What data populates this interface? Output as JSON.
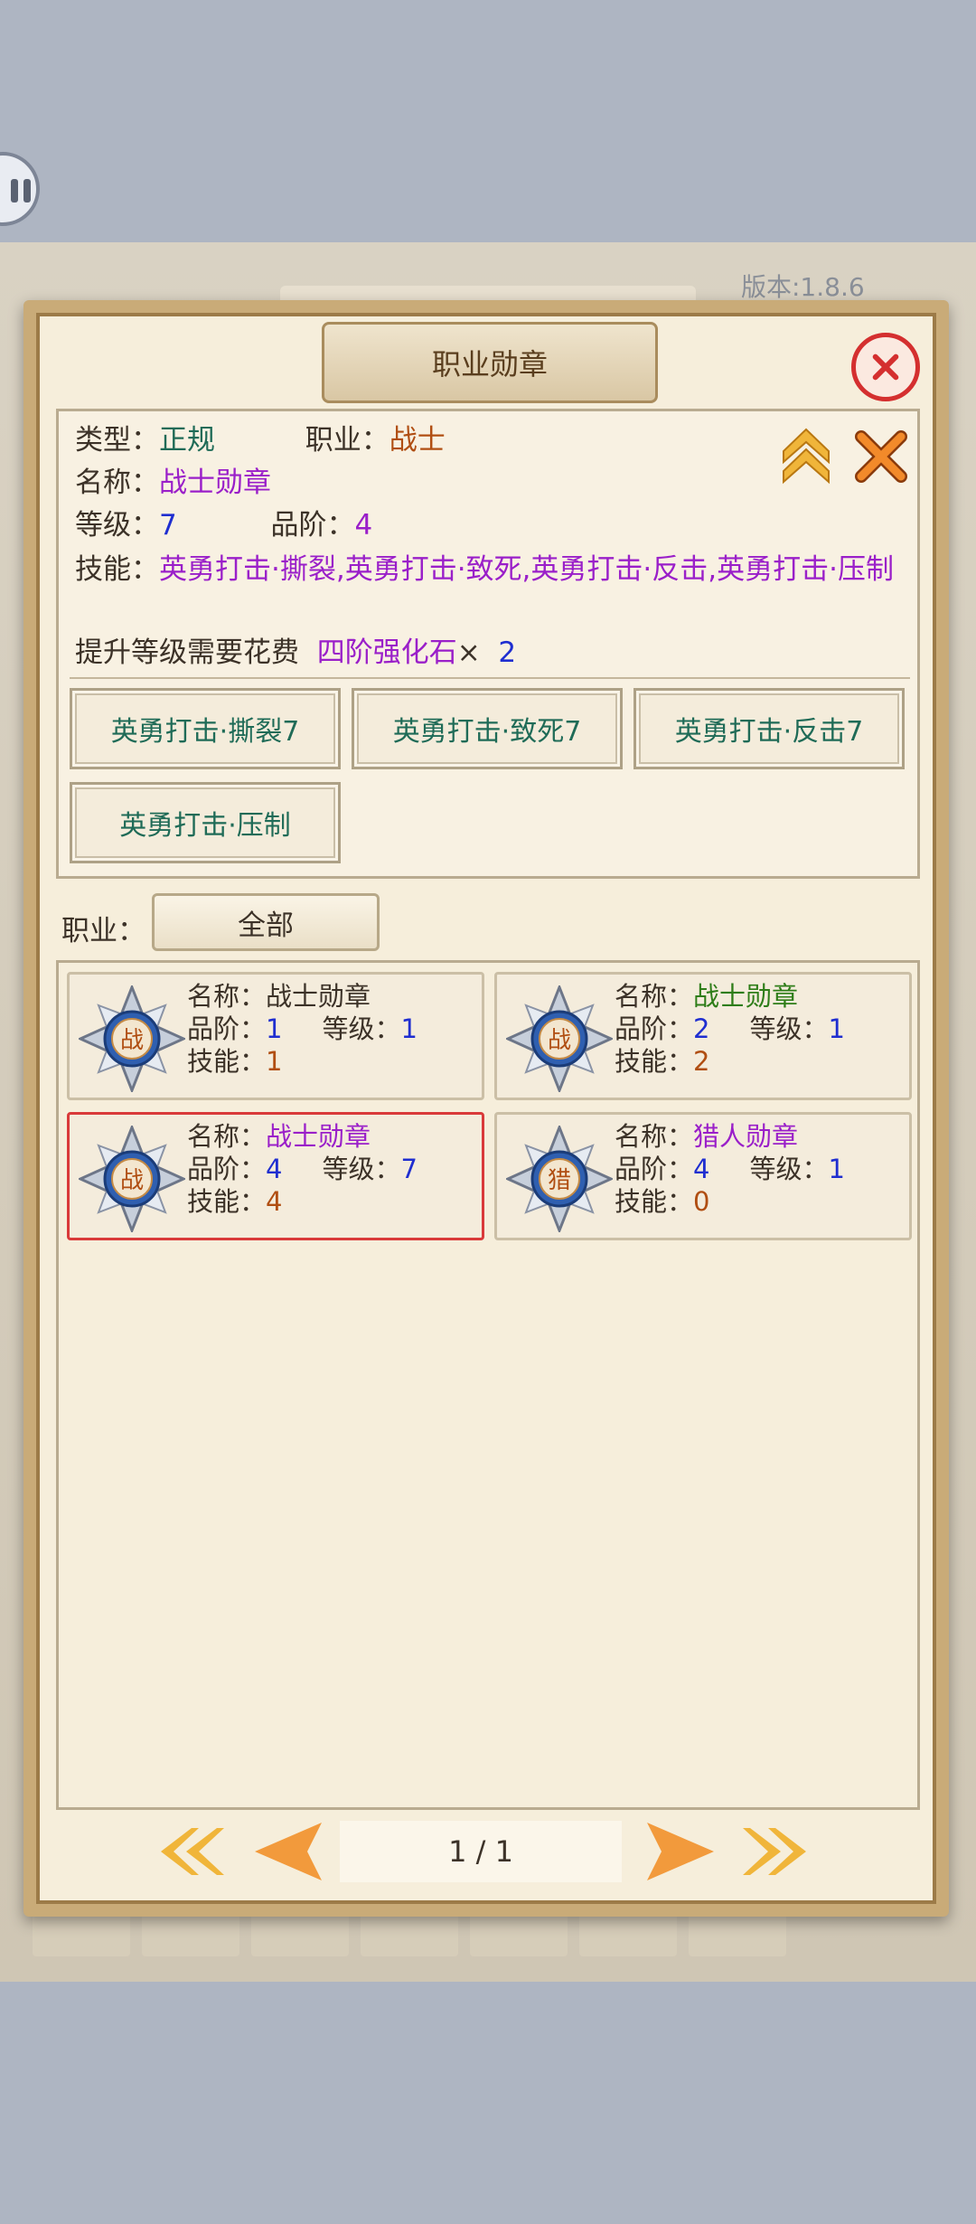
{
  "background": {
    "version_text": "版本:1.8.6"
  },
  "panel": {
    "title": "职业勋章"
  },
  "detail": {
    "type_label": "类型：",
    "type_value": "正规",
    "job_label": "职业：",
    "job_value": "战士",
    "name_label": "名称：",
    "name_value": "战士勋章",
    "level_label": "等级：",
    "level_value": "7",
    "grade_label": "品阶：",
    "grade_value": "4",
    "skills_label": "技能：",
    "skills_value": "英勇打击·撕裂,英勇打击·致死,英勇打击·反击,英勇打击·压制",
    "cost_label": "提升等级需要花费",
    "cost_item": "四阶强化石",
    "cost_times": "×",
    "cost_count": "2",
    "skill_buttons": [
      "英勇打击·撕裂7",
      "英勇打击·致死7",
      "英勇打击·反击7",
      "英勇打击·压制"
    ]
  },
  "filter": {
    "label": "职业：",
    "selected": "全部"
  },
  "medals": [
    {
      "icon_char": "战",
      "name_label": "名称：",
      "name": "战士勋章",
      "name_color": "#3c3228",
      "grade_label": "品阶：",
      "grade": "1",
      "level_label": "等级：",
      "level": "1",
      "skill_label": "技能：",
      "skill": "1",
      "selected": false
    },
    {
      "icon_char": "战",
      "name_label": "名称：",
      "name": "战士勋章",
      "name_color": "#2e7d18",
      "grade_label": "品阶：",
      "grade": "2",
      "level_label": "等级：",
      "level": "1",
      "skill_label": "技能：",
      "skill": "2",
      "selected": false
    },
    {
      "icon_char": "战",
      "name_label": "名称：",
      "name": "战士勋章",
      "name_color": "#9a1fc9",
      "grade_label": "品阶：",
      "grade": "4",
      "level_label": "等级：",
      "level": "7",
      "skill_label": "技能：",
      "skill": "4",
      "selected": true
    },
    {
      "icon_char": "猎",
      "name_label": "名称：",
      "name": "猎人勋章",
      "name_color": "#9a1fc9",
      "grade_label": "品阶：",
      "grade": "4",
      "level_label": "等级：",
      "level": "1",
      "skill_label": "技能：",
      "skill": "0",
      "selected": false
    }
  ],
  "pager": {
    "page_text": "1 / 1"
  },
  "colors": {
    "accent_red": "#d42f2f",
    "gold": "#f0b53a",
    "arrow_orange": "#f29a3c",
    "teal": "#1f6b57",
    "purple": "#9a1fc9",
    "blue": "#1f2ed0"
  }
}
